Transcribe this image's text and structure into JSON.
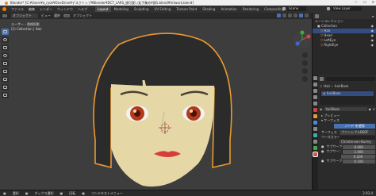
{
  "window": {
    "title": "Blender* [C:¥Users¥a_ryok¥OneDrive¥デスクトップ¥Blender¥DCT_LARS_顔可愛い女子集め¥顔1.blend¥Artwork.blend]",
    "controls": [
      "—",
      "☐",
      "✕"
    ]
  },
  "menubar": {
    "menus": [
      "ファイル",
      "編集",
      "レンダー",
      "ウィンドウ",
      "ヘルプ"
    ],
    "workspaces": [
      "Layout",
      "Modeling",
      "Sculpting",
      "UV Editing",
      "Texture Paint",
      "Shading",
      "Animation",
      "Rendering",
      "Compositing",
      "Scripting"
    ],
    "active_workspace": "Layout",
    "scene": "Scene",
    "view_layer": "View Layer"
  },
  "viewport": {
    "header": [
      "オブジェクト",
      "ビュー",
      "選択",
      "追加",
      "オブジェクト"
    ],
    "info_line1": "ユーザー・透視投影",
    "info_line2": "(1) Collection | Hair"
  },
  "outliner": {
    "title": "シーンコレクション",
    "items": [
      {
        "label": "Collection",
        "selected": false
      },
      {
        "label": "Hair",
        "selected": true
      },
      {
        "label": "Head",
        "selected": false
      },
      {
        "label": "LeftEye",
        "selected": false
      },
      {
        "label": "RightEye",
        "selected": false
      }
    ]
  },
  "properties": {
    "object": "Hair",
    "material_slot": "hairBase",
    "material_name": "hairBase",
    "sections": [
      "プレビュー",
      "サーフェス"
    ],
    "surface_value": "ノード を使用",
    "surface_label": "サーフェス",
    "shader": "プリンシプルBSDF",
    "base_color_label": "ベースカラー",
    "subsurface_label": "サブサーフェス",
    "method": "Christensen-Burley",
    "subsurface_values": [
      "0.000",
      "1.000",
      "0.200",
      "0.100"
    ],
    "subsurface_radius": "サブサーフェス範囲"
  },
  "status": {
    "items": [
      "選択",
      "ボックス選択",
      "回転",
      "コンテキストメニュー"
    ],
    "version": "2.93.4"
  },
  "colors": {
    "accent": "#4772b3",
    "hair": "#2b2b2b",
    "skin": "#e6d7a6",
    "outline": "#e89a30",
    "eye": "#b23a18",
    "lips": "#d83c3c"
  }
}
